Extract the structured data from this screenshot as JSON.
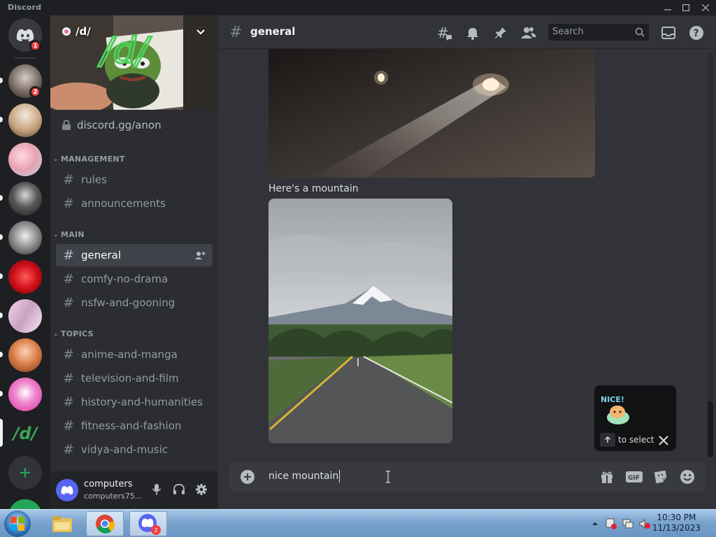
{
  "window": {
    "app_name": "Discord",
    "controls": [
      "minimize",
      "maximize",
      "close"
    ]
  },
  "rail": {
    "home_badge": "1",
    "server_badge": "2",
    "active_server_label": "/d/",
    "add_server": "add-server"
  },
  "server": {
    "name": "/d/",
    "invite": "discord.gg/anon",
    "categories": [
      {
        "name": "MANAGEMENT",
        "channels": [
          "rules",
          "announcements"
        ]
      },
      {
        "name": "MAIN",
        "channels": [
          "general",
          "comfy-no-drama",
          "nsfw-and-gooning"
        ]
      },
      {
        "name": "TOPICS",
        "channels": [
          "anime-and-manga",
          "television-and-film",
          "history-and-humanities",
          "fitness-and-fashion",
          "vidya-and-music"
        ]
      }
    ],
    "active_channel": "general"
  },
  "user": {
    "name": "computers",
    "tag": "computers75..."
  },
  "channel": {
    "title": "general",
    "search_placeholder": "Search"
  },
  "messages": [
    {
      "type": "image",
      "description": "night-lights"
    },
    {
      "type": "text",
      "text": "Here's a mountain"
    },
    {
      "type": "image",
      "description": "mountain-road"
    }
  ],
  "sticker_suggestion": {
    "label": "to select",
    "sticker_text": "NICE!"
  },
  "composer": {
    "value": "nice mountain"
  },
  "taskbar": {
    "time": "10:30 PM",
    "date": "11/13/2023",
    "discord_badge": "2"
  },
  "colors": {
    "accent": "#5865f2",
    "danger": "#f23f43",
    "green": "#23a55a",
    "bg": "#313338"
  }
}
